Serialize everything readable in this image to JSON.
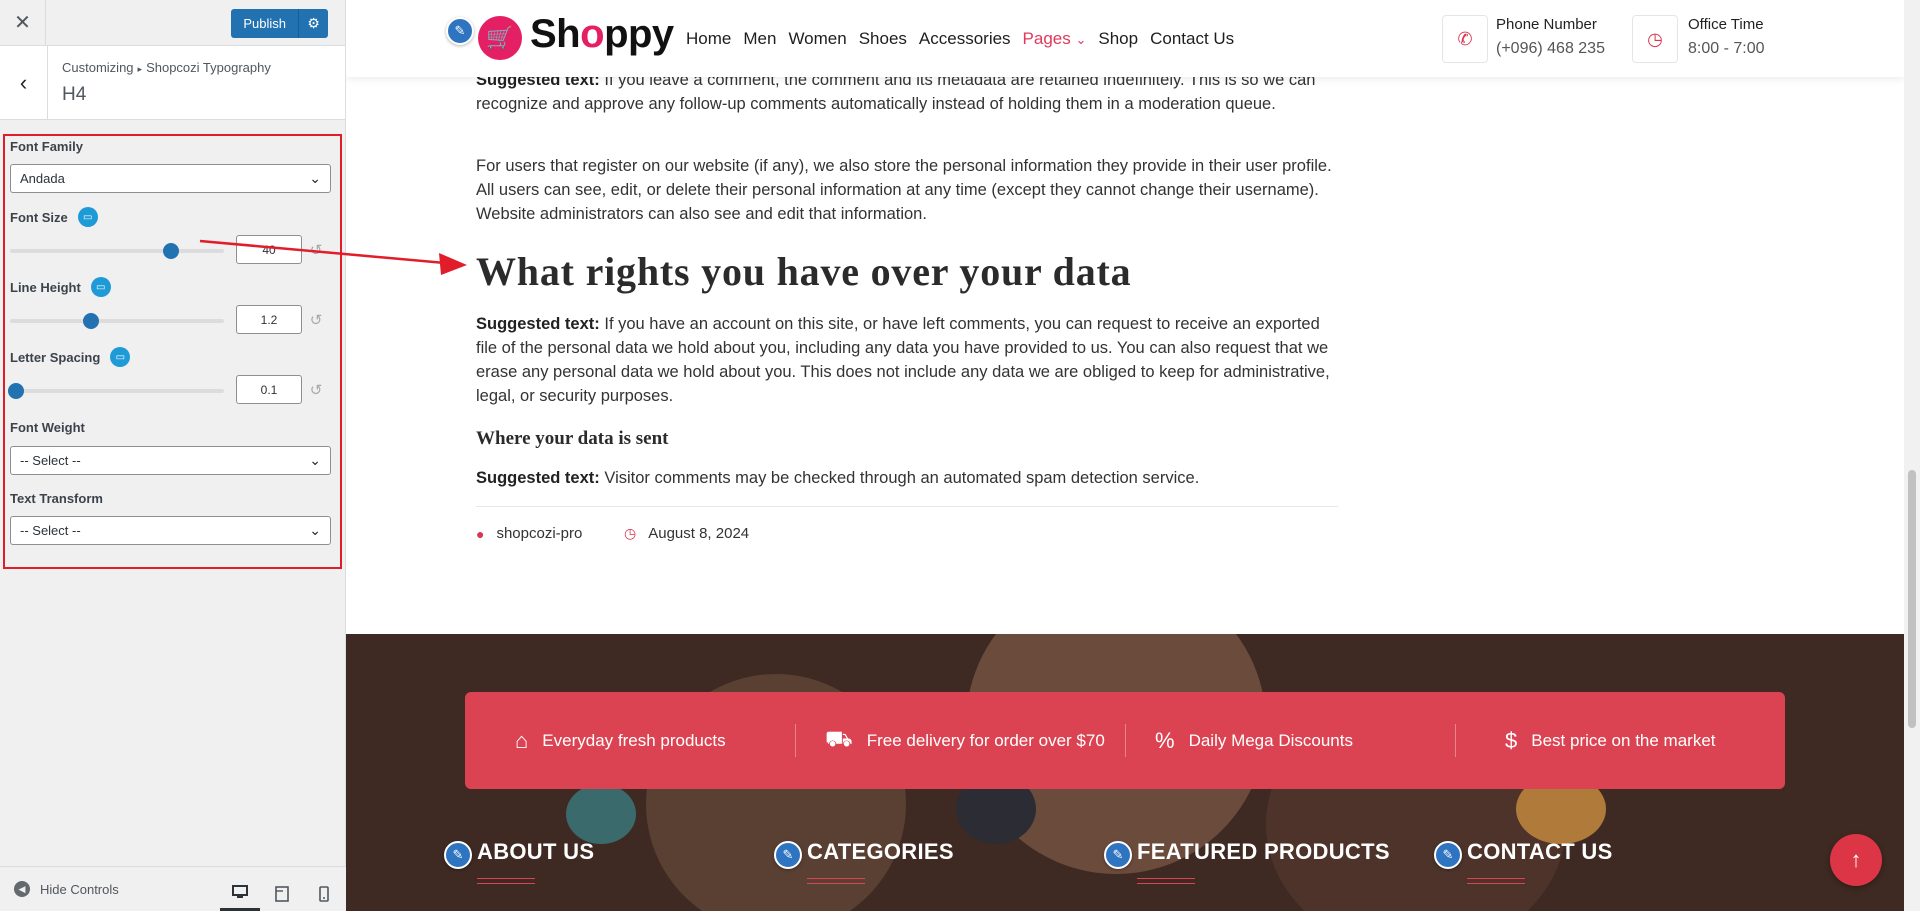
{
  "customizer": {
    "close_icon": "close-icon",
    "publish_label": "Publish",
    "breadcrumb_root": "Customizing",
    "breadcrumb_section": "Shopcozi Typography",
    "section_title": "H4",
    "controls": {
      "font_family": {
        "label": "Font Family",
        "value": "Andada"
      },
      "font_size": {
        "label": "Font Size",
        "value": "40",
        "slider_fraction": 0.75
      },
      "line_height": {
        "label": "Line Height",
        "value": "1.2",
        "slider_fraction": 0.38
      },
      "letter_spacing": {
        "label": "Letter Spacing",
        "value": "0.1",
        "slider_fraction": 0.03
      },
      "font_weight": {
        "label": "Font Weight",
        "value": "-- Select --"
      },
      "text_transform": {
        "label": "Text Transform",
        "value": "-- Select --"
      }
    },
    "hide_controls_label": "Hide Controls",
    "accent_color": "#2271b1",
    "highlight_color": "#e11d2a"
  },
  "site": {
    "logo_text_1": "Sh",
    "logo_text_2": "o",
    "logo_text_3": "ppy",
    "nav": [
      "Home",
      "Men",
      "Women",
      "Shoes",
      "Accessories",
      "Pages",
      "Shop",
      "Contact Us"
    ],
    "nav_active": "Pages",
    "phone_label": "Phone Number",
    "phone_value": "(+096) 468 235",
    "office_label": "Office Time",
    "office_value": "8:00 - 7:00",
    "brand_color": "#e41f64"
  },
  "article": {
    "p1_bold": "Suggested text:",
    "p1": " If you leave a comment, the comment and its metadata are retained indefinitely. This is so we can recognize and approve any follow-up comments automatically instead of holding them in a moderation queue.",
    "p2": "For users that register on our website (if any), we also store the personal information they provide in their user profile. All users can see, edit, or delete their personal information at any time (except they cannot change their username). Website administrators can also see and edit that information.",
    "heading_rights": "What rights you have over your data",
    "p3_bold": "Suggested text:",
    "p3": " If you have an account on this site, or have left comments, you can request to receive an exported file of the personal data we hold about you, including any data you have provided to us. You can also request that we erase any personal data we hold about you. This does not include any data we are obliged to keep for administrative, legal, or security purposes.",
    "heading_sent": "Where your data is sent",
    "p4_bold": "Suggested text:",
    "p4": " Visitor comments may be checked through an automated spam detection service.",
    "author": "shopcozi-pro",
    "date": "August 8, 2024"
  },
  "footer": {
    "features": [
      "Everyday fresh products",
      "Free delivery for order over $70",
      "Daily Mega Discounts",
      "Best price on the market"
    ],
    "columns": [
      "ABOUT US",
      "CATEGORIES",
      "FEATURED PRODUCTS",
      "CONTACT US"
    ],
    "feature_color": "#dc4352"
  }
}
